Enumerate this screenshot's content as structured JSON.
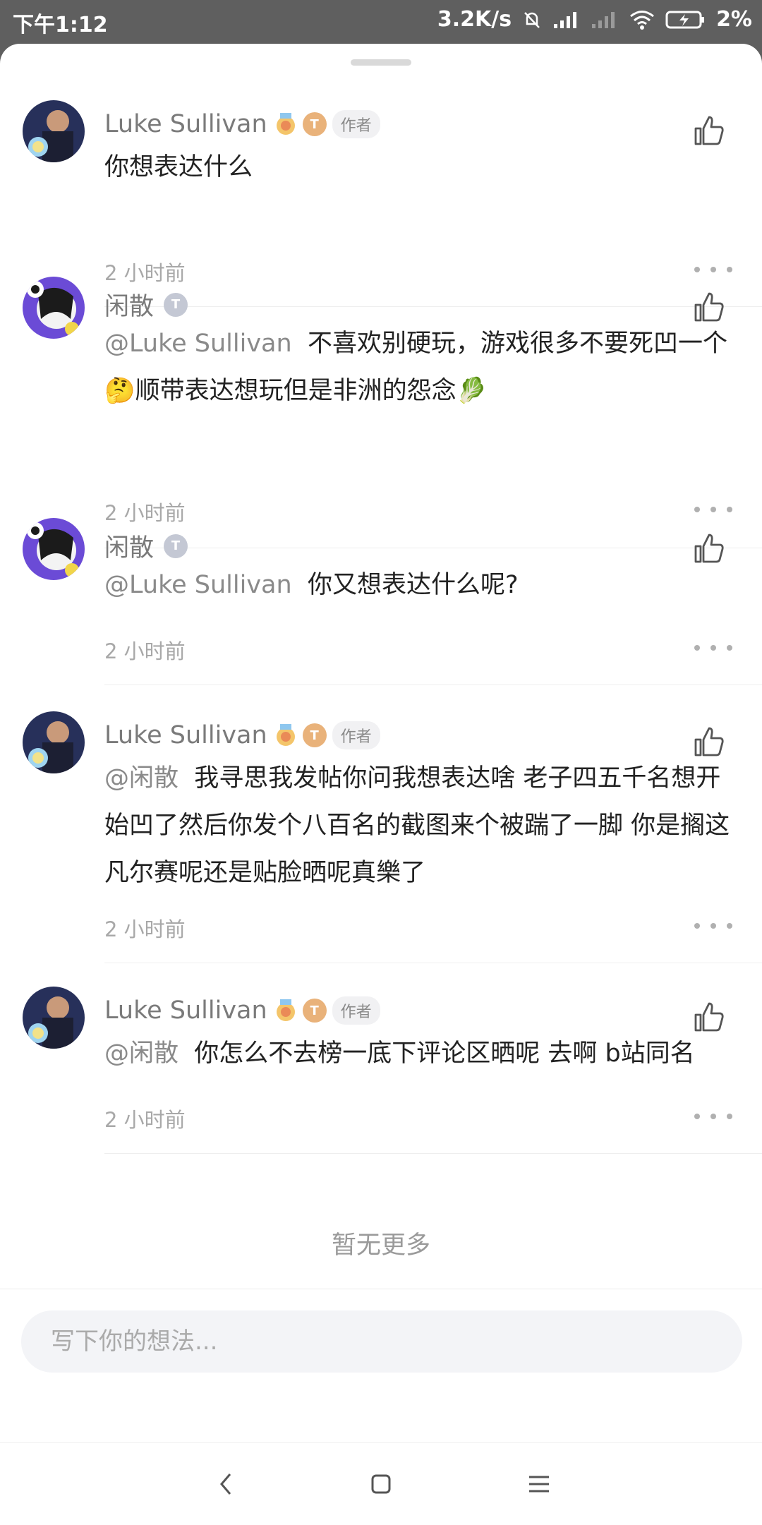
{
  "status_bar": {
    "time": "下午1:12",
    "speed": "3.2K/s",
    "battery": "2%"
  },
  "comments": [
    {
      "username": "Luke Sullivan",
      "is_author": true,
      "author_tag": "作者",
      "level_badge": "T",
      "mention": "",
      "text": "你想表达什么",
      "time": "2 小时前"
    },
    {
      "username": "闲散",
      "is_author": false,
      "level_badge": "T",
      "mention": "@Luke Sullivan",
      "text": "不喜欢别硬玩，游戏很多不要死凹一个",
      "text_line2": "顺带表达想玩但是非洲的怨念",
      "emoji_start": "🤔",
      "emoji_end": "🥬",
      "time": "2 小时前"
    },
    {
      "username": "闲散",
      "is_author": false,
      "level_badge": "T",
      "mention": "@Luke Sullivan",
      "text": "你又想表达什么呢?",
      "time": "2 小时前"
    },
    {
      "username": "Luke Sullivan",
      "is_author": true,
      "author_tag": "作者",
      "level_badge": "T",
      "mention": "@闲散",
      "text": "我寻思我发帖你问我想表达啥 老子四五千名想开始凹了然后你发个八百名的截图来个被踹了一脚 你是搁这凡尔赛呢还是贴脸晒呢真樂了",
      "time": "2 小时前"
    },
    {
      "username": "Luke Sullivan",
      "is_author": true,
      "author_tag": "作者",
      "level_badge": "T",
      "mention": "@闲散",
      "text": "你怎么不去榜一底下评论区晒呢 去啊 b站同名",
      "time": "2 小时前"
    }
  ],
  "end_text": "暂无更多",
  "input": {
    "placeholder": "写下你的想法..."
  },
  "colors": {
    "status_bar_bg": "#5f5f5f",
    "secondary_text": "#7a7a7a",
    "timestamp": "#a8a8a8",
    "author_tag_bg": "#f1f1f3",
    "gold_badge": "#e9b27a",
    "silver_badge": "#c4c8d4"
  },
  "icons": {
    "like": "thumb-up-icon",
    "more": "more-dots-icon",
    "back": "chevron-left-icon",
    "home": "square-icon",
    "menu": "hamburger-icon"
  }
}
